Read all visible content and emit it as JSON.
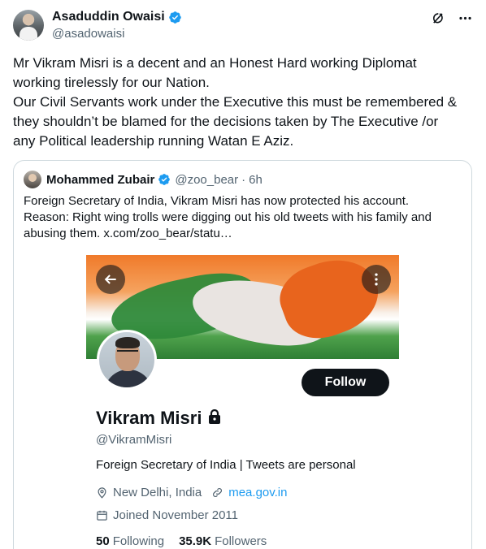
{
  "post": {
    "author_name": "Asaduddin Owaisi",
    "handle": "@asadowaisi",
    "text_lines": [
      "Mr Vikram Misri is a decent and an Honest Hard working Diplomat",
      "working tirelessly for our Nation.",
      "Our Civil Servants work under the Executive this must be remembered &",
      "they shouldn’t be blamed for the decisions taken by The Executive /or",
      "any Political leadership running Watan E Aziz."
    ],
    "actions": {
      "grok_icon": "grok-icon",
      "more_icon": "more-icon"
    }
  },
  "quote": {
    "author_name": "Mohammed Zubair",
    "handle": "@zoo_bear",
    "dot": "·",
    "time": "6h",
    "text_lines": [
      "Foreign Secretary of India, Vikram Misri has now protected his account.",
      "Reason: Right wing trolls were digging out his old tweets with his family and",
      "abusing them.  x.com/zoo_bear/statu…"
    ]
  },
  "profile": {
    "follow_label": "Follow",
    "name": "Vikram Misri",
    "handle": "@VikramMisri",
    "bio": "Foreign Secretary of India | Tweets are personal",
    "location": "New Delhi, India",
    "website": "mea.gov.in",
    "joined": "Joined November 2011",
    "following_count": "50",
    "following_label": "Following",
    "followers_count": "35.9K",
    "followers_label": "Followers"
  },
  "colors": {
    "text": "#0f1419",
    "muted": "#536471",
    "link": "#1d9bf0",
    "verified": "#1d9bf0",
    "border": "#cfd9de"
  }
}
